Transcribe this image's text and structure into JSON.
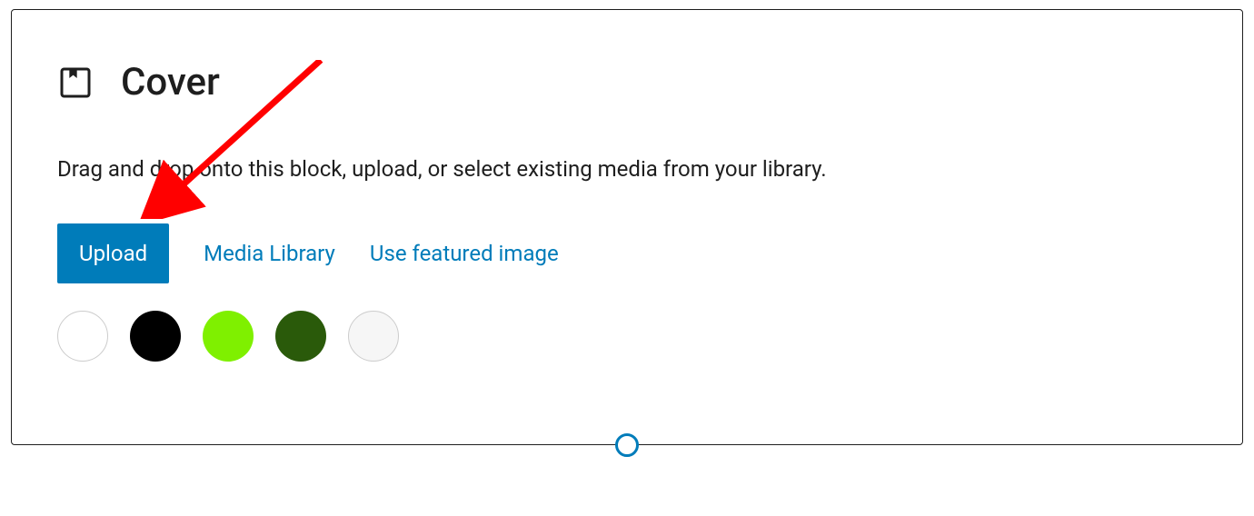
{
  "block": {
    "title": "Cover",
    "description": "Drag and drop onto this block, upload, or select existing media from your library.",
    "buttons": {
      "upload": "Upload",
      "media_library": "Media Library",
      "featured_image": "Use featured image"
    },
    "colors": [
      {
        "name": "white",
        "value": "#ffffff",
        "bordered": true
      },
      {
        "name": "black",
        "value": "#000000",
        "bordered": false
      },
      {
        "name": "lime-green",
        "value": "#7ff000",
        "bordered": false
      },
      {
        "name": "dark-green",
        "value": "#2a5a0a",
        "bordered": false
      },
      {
        "name": "light-gray",
        "value": "#f6f6f6",
        "bordered": true
      }
    ]
  },
  "annotation": {
    "arrow_color": "#ff0000"
  }
}
